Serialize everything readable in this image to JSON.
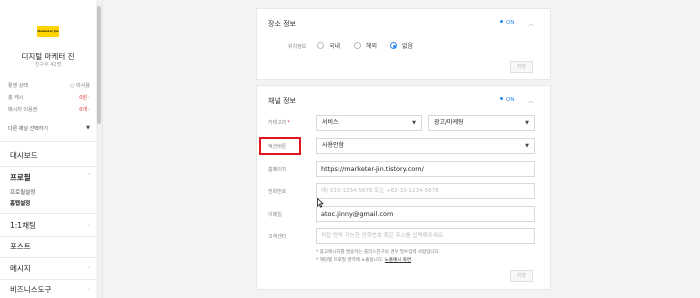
{
  "sidebar": {
    "logo_text": "Marketer Jin",
    "channel_name": "디지털 마케터 진",
    "friends": "친구수 42명",
    "stats": [
      {
        "label": "활영 상태",
        "value": "○ 미사용",
        "red": false,
        "chevron": false
      },
      {
        "label": "총 캐시",
        "value": "0원",
        "red": true,
        "chevron": true
      },
      {
        "label": "메시지 이용권",
        "value": "0개",
        "red": true,
        "chevron": true
      }
    ],
    "channel_select": "다른 채널 선택하기",
    "nav": {
      "dashboard": "대시보드",
      "profile": "프로필",
      "profile_setting": "프로필설정",
      "home_setting": "홈탭설정",
      "chat": "1:1채팅",
      "post": "포스트",
      "message": "메시지",
      "business_tools": "비즈니스도구"
    }
  },
  "place_info": {
    "title": "장소 정보",
    "status": "ON",
    "location_label": "위치정보",
    "options": [
      "국내",
      "해외",
      "없음"
    ],
    "selected": "없음",
    "save": "저장"
  },
  "channel_info": {
    "title": "채널 정보",
    "status": "ON",
    "category_label": "카테고리",
    "category_1": "서비스",
    "category_2": "광고/마케팅",
    "consult_label": "액션버튼",
    "consult_value": "사용안함",
    "homepage_label": "홈페이지",
    "homepage_value": "https://marketer-jin.tistory.com/",
    "phone_label": "전화번호",
    "phone_placeholder": "예) 010-1234-5678 또는 +82-10-1234-5678",
    "email_label": "이메일",
    "email_value": "atoc.jinny@gmail.com",
    "cs_label": "고객센터",
    "cs_placeholder": "직접 연락 가능한 전화번호 혹은 주소를 입력해주세요.",
    "note_1": "* 광고메시지를 발송하는 플러스친구의 경우 필수입력 사항입니다.",
    "note_2_prefix": "* 해당탭 프로필 영역에 노출됩니다. ",
    "note_2_link": "노출예시 화면",
    "save": "저장"
  },
  "colors": {
    "accent": "#2d8cf0",
    "highlight": "#e0161e",
    "logo": "#ffd400"
  }
}
